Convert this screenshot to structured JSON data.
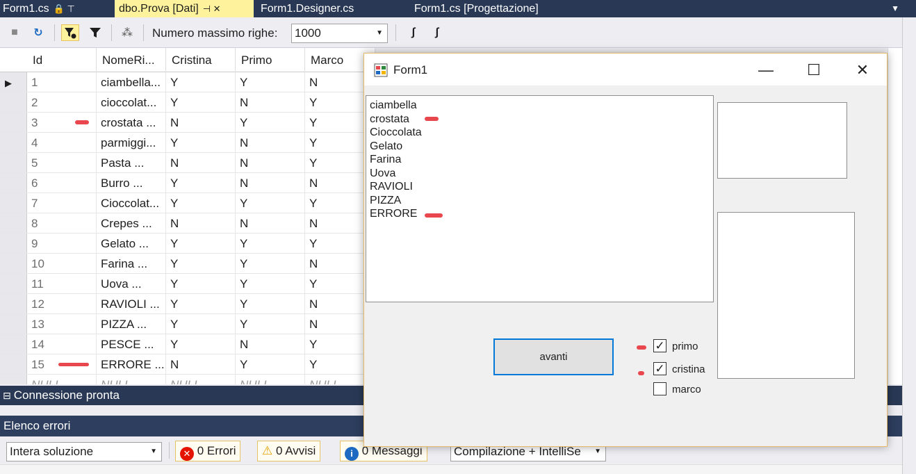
{
  "tabs": [
    {
      "label": "Form1.cs",
      "glyphs": "🔒 ⊤"
    },
    {
      "label": "dbo.Prova [Dati]",
      "glyphs": "⊣ ✕"
    },
    {
      "label": "Form1.Designer.cs"
    },
    {
      "label": "Form1.cs [Progettazione]"
    }
  ],
  "toolbar": {
    "max_rows_label": "Numero massimo righe:",
    "max_rows_value": "1000"
  },
  "grid": {
    "columns": [
      "Id",
      "NomeRi...",
      "Cristina",
      "Primo",
      "Marco"
    ],
    "rows": [
      [
        "1",
        "ciambella...",
        "Y",
        "Y",
        "N"
      ],
      [
        "2",
        "cioccolat...",
        "Y",
        "N",
        "Y"
      ],
      [
        "3",
        "crostata  ...",
        "N",
        "Y",
        "Y"
      ],
      [
        "4",
        "parmiggi...",
        "Y",
        "N",
        "Y"
      ],
      [
        "5",
        "Pasta      ...",
        "N",
        "N",
        "Y"
      ],
      [
        "6",
        "Burro      ...",
        "Y",
        "N",
        "N"
      ],
      [
        "7",
        "Cioccolat...",
        "Y",
        "Y",
        "Y"
      ],
      [
        "8",
        "Crepes    ...",
        "N",
        "N",
        "N"
      ],
      [
        "9",
        "Gelato    ...",
        "Y",
        "Y",
        "Y"
      ],
      [
        "10",
        "Farina    ...",
        "Y",
        "Y",
        "N"
      ],
      [
        "11",
        "Uova      ...",
        "Y",
        "Y",
        "Y"
      ],
      [
        "12",
        "RAVIOLI  ...",
        "Y",
        "Y",
        "N"
      ],
      [
        "13",
        "PIZZA     ...",
        "Y",
        "Y",
        "N"
      ],
      [
        "14",
        "PESCE    ...",
        "Y",
        "N",
        "Y"
      ],
      [
        "15",
        "ERRORE ...",
        "N",
        "Y",
        "Y"
      ]
    ],
    "null_row": [
      "NULL",
      "NULL",
      "NULL",
      "NULL",
      "NULL"
    ]
  },
  "status": {
    "text": "Connessione pronta"
  },
  "error_list": {
    "title": "Elenco errori",
    "scope": "Intera soluzione",
    "errors": "0 Errori",
    "warnings": "0 Avvisi",
    "messages": "0 Messaggi",
    "build_filter": "Compilazione + IntelliSe"
  },
  "form1": {
    "title": "Form1",
    "list_items": [
      "ciambella",
      "crostata",
      "Cioccolata",
      "Gelato",
      "Farina",
      "Uova",
      "RAVIOLI",
      "PIZZA",
      "ERRORE"
    ],
    "button": "avanti",
    "checkboxes": [
      {
        "label": "primo",
        "checked": true
      },
      {
        "label": "cristina",
        "checked": true
      },
      {
        "label": "marco",
        "checked": false
      }
    ]
  },
  "colors": {
    "accent": "#0078d7",
    "tab_active": "#fff29d",
    "ide_dark": "#293955",
    "annotation_red": "#e8474d"
  }
}
